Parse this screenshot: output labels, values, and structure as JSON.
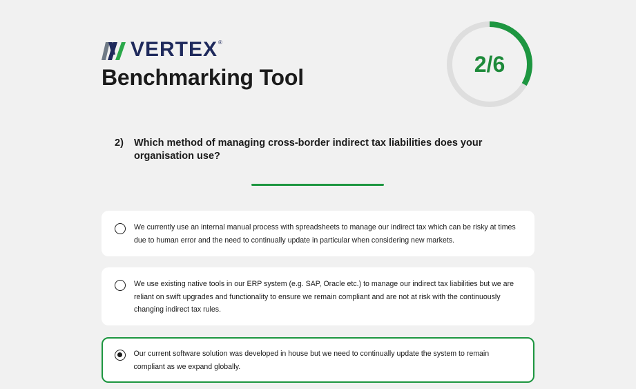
{
  "brand": {
    "name": "VERTEX",
    "registered": "®"
  },
  "header": {
    "title": "Benchmarking Tool"
  },
  "progress": {
    "label": "2/6",
    "current": 2,
    "total": 6,
    "color": "#1d8a3a"
  },
  "question": {
    "number": "2)",
    "text": "Which method of managing cross-border indirect tax liabilities does your organisation use?"
  },
  "options": [
    {
      "text": "We currently use an internal manual process with spreadsheets to manage our indirect tax which can be risky at times due to human error and the need to continually update in particular when considering new markets.",
      "selected": false
    },
    {
      "text": "We use existing native tools in our ERP system (e.g. SAP, Oracle etc.) to manage our indirect tax liabilities but we are reliant on swift upgrades and functionality to ensure we remain compliant and are not at risk with the continuously changing indirect tax rules.",
      "selected": false
    },
    {
      "text": "Our current software solution was developed in house but we need to continually update the system to remain compliant as we expand globally.",
      "selected": true
    }
  ],
  "colors": {
    "accent": "#1d9640",
    "brand_navy": "#1f2a5c",
    "background": "#f1f1f1"
  }
}
